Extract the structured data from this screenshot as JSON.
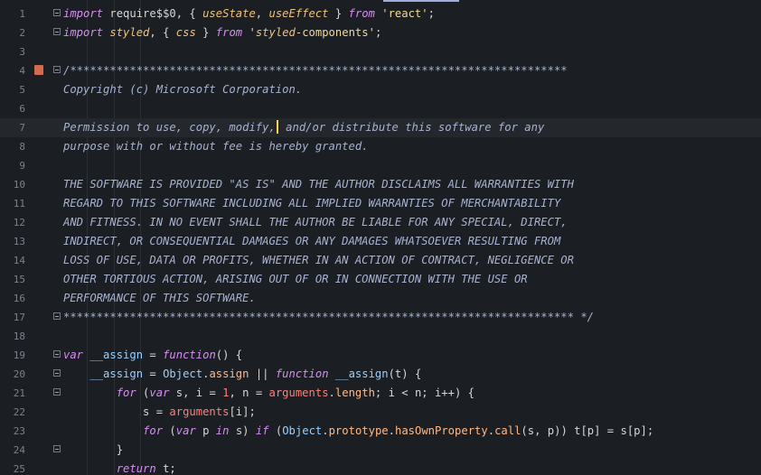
{
  "editor": {
    "lines": [
      {
        "no": "1",
        "code": "import require$$0, { useState, useEffect } from 'react';"
      },
      {
        "no": "2",
        "code": "import styled, { css } from 'styled-components';"
      },
      {
        "no": "3",
        "code": ""
      },
      {
        "no": "4",
        "code": "/***************************************************************************"
      },
      {
        "no": "5",
        "code": "Copyright (c) Microsoft Corporation."
      },
      {
        "no": "6",
        "code": ""
      },
      {
        "no": "7",
        "code": "Permission to use, copy, modify, and/or distribute this software for any"
      },
      {
        "no": "8",
        "code": "purpose with or without fee is hereby granted."
      },
      {
        "no": "9",
        "code": ""
      },
      {
        "no": "10",
        "code": "THE SOFTWARE IS PROVIDED \"AS IS\" AND THE AUTHOR DISCLAIMS ALL WARRANTIES WITH"
      },
      {
        "no": "11",
        "code": "REGARD TO THIS SOFTWARE INCLUDING ALL IMPLIED WARRANTIES OF MERCHANTABILITY"
      },
      {
        "no": "12",
        "code": "AND FITNESS. IN NO EVENT SHALL THE AUTHOR BE LIABLE FOR ANY SPECIAL, DIRECT,"
      },
      {
        "no": "13",
        "code": "INDIRECT, OR CONSEQUENTIAL DAMAGES OR ANY DAMAGES WHATSOEVER RESULTING FROM"
      },
      {
        "no": "14",
        "code": "LOSS OF USE, DATA OR PROFITS, WHETHER IN AN ACTION OF CONTRACT, NEGLIGENCE OR"
      },
      {
        "no": "15",
        "code": "OTHER TORTIOUS ACTION, ARISING OUT OF OR IN CONNECTION WITH THE USE OR"
      },
      {
        "no": "16",
        "code": "PERFORMANCE OF THIS SOFTWARE."
      },
      {
        "no": "17",
        "code": "***************************************************************************** */"
      },
      {
        "no": "18",
        "code": ""
      },
      {
        "no": "19",
        "code": "var __assign = function() {"
      },
      {
        "no": "20",
        "code": "    __assign = Object.assign || function __assign(t) {"
      },
      {
        "no": "21",
        "code": "        for (var s, i = 1, n = arguments.length; i < n; i++) {"
      },
      {
        "no": "22",
        "code": "            s = arguments[i];"
      },
      {
        "no": "23",
        "code": "            for (var p in s) if (Object.prototype.hasOwnProperty.call(s, p)) t[p] = s[p];"
      },
      {
        "no": "24",
        "code": "        }"
      },
      {
        "no": "25",
        "code": "        return t;"
      }
    ],
    "active_line": "7",
    "bookmark_icon": "bookmark-icon",
    "fold_icon": "fold-icon",
    "colors": {
      "background": "#1b1e22",
      "active_line": "#24282d",
      "keyword": "#d58ef3",
      "string": "#f0db9a",
      "comment": "#a8b2d1",
      "number": "#ff7f7f",
      "cursor": "#ffd447"
    }
  }
}
